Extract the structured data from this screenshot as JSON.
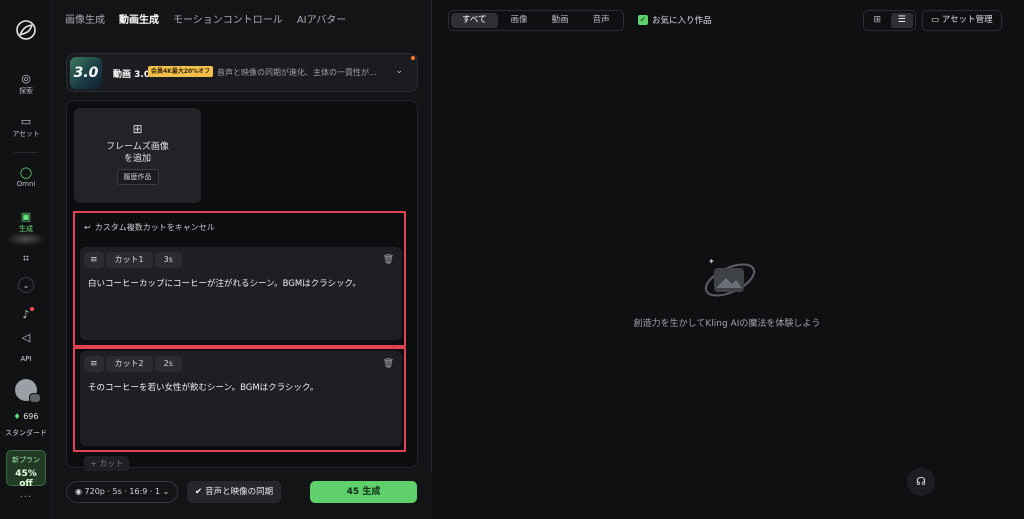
{
  "rail": {
    "items": [
      {
        "icon": "explore-icon",
        "label": "探索"
      },
      {
        "icon": "folder-icon",
        "label": "アセット"
      },
      {
        "icon": "omni-icon",
        "label": "Omni"
      },
      {
        "icon": "create-icon",
        "label": "生成"
      },
      {
        "icon": "frame-icon",
        "label": ""
      },
      {
        "icon": "chevron-down-icon",
        "label": ""
      },
      {
        "icon": "bell-icon",
        "label": ""
      },
      {
        "icon": "megaphone-icon",
        "label": ""
      },
      {
        "icon": "api-icon",
        "label": "API"
      }
    ],
    "credits": "696",
    "plan": "スタンダード",
    "promo_line1": "新プラン",
    "promo_line2": "45% off",
    "more": "···"
  },
  "topnav": {
    "tabs": [
      "画像生成",
      "動画生成",
      "モーションコントロール",
      "AIアバター"
    ],
    "active": "動画生成"
  },
  "model": {
    "thumb_text": "3.0",
    "name": "動画 3.0",
    "badge": "会員4K最大20%オフ",
    "desc": "音声と映像の同期が進化、主体の一貫性が..."
  },
  "frame": {
    "label_line1": "フレームズ画像",
    "label_line2": "を追加",
    "history": "履歴作品"
  },
  "cancel_label": "カスタム複数カットをキャンセル",
  "shots": [
    {
      "cut": "カット1",
      "duration": "3s",
      "text": "白いコーヒーカップにコーヒーが注がれるシーン。BGMはクラシック。"
    },
    {
      "cut": "カット2",
      "duration": "2s",
      "text": "そのコーヒーを若い女性が飲むシーン。BGMはクラシック。"
    }
  ],
  "add_cut": "+ カット",
  "bottom": {
    "settings": "720p · 5s · 16:9 · 1",
    "sync": "音声と映像の同期",
    "generate": "45  生成"
  },
  "right": {
    "filters": [
      "すべて",
      "画像",
      "動画",
      "音声"
    ],
    "favorites": "お気に入り作品",
    "assets": "アセット管理",
    "empty": "創造力を生かしてKling AIの魔法を体験しよう"
  }
}
